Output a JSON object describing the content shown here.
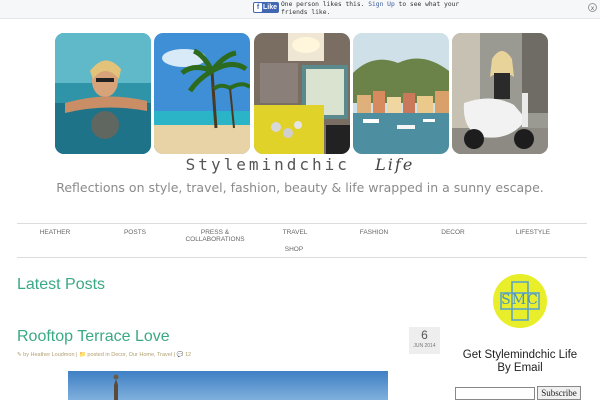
{
  "fb_bar": {
    "like_label": "Like",
    "message_before": "One person likes this. ",
    "signup_label": "Sign Up",
    "message_after": " to see what your friends like.",
    "close_symbol": "x"
  },
  "header": {
    "photos": [
      {
        "icon": "woman-in-pool-photo"
      },
      {
        "icon": "palm-beach-photo"
      },
      {
        "icon": "accessories-flatlay-photo"
      },
      {
        "icon": "harbor-village-photo"
      },
      {
        "icon": "woman-on-scooter-photo"
      }
    ],
    "site_title": "Stylemindchic",
    "site_title_script": "Life",
    "tagline": "Reflections on style, travel, fashion, beauty & life wrapped in a sunny escape."
  },
  "nav": {
    "items": [
      {
        "label": "HEATHER"
      },
      {
        "label": "POSTS"
      },
      {
        "label": "PRESS &"
      },
      {
        "label": "COLLABORATIONS"
      },
      {
        "label": "TRAVEL"
      },
      {
        "label": "FASHION"
      },
      {
        "label": "DECOR"
      },
      {
        "label": "LIFESTYLE"
      },
      {
        "label": "SHOP"
      }
    ]
  },
  "main": {
    "section_title": "Latest Posts",
    "post": {
      "title": "Rooftop Terrace Love",
      "meta_author": "by Heather Loudmon |",
      "meta_categories": "posted in Decor, Our Home, Travel |",
      "meta_comments": "12",
      "date_day": "6",
      "date_month": "JUN 2014"
    }
  },
  "sidebar": {
    "logo_text": "SMC",
    "widget_title_line1": "Get Stylemindchic Life",
    "widget_title_line2": "By Email",
    "subscribe_label": "Subscribe",
    "email_placeholder": ""
  },
  "colors": {
    "accent": "#3aa985",
    "logo_yellow": "#e8ef2a",
    "fb_blue": "#4267b2",
    "meta": "#b0a070"
  }
}
